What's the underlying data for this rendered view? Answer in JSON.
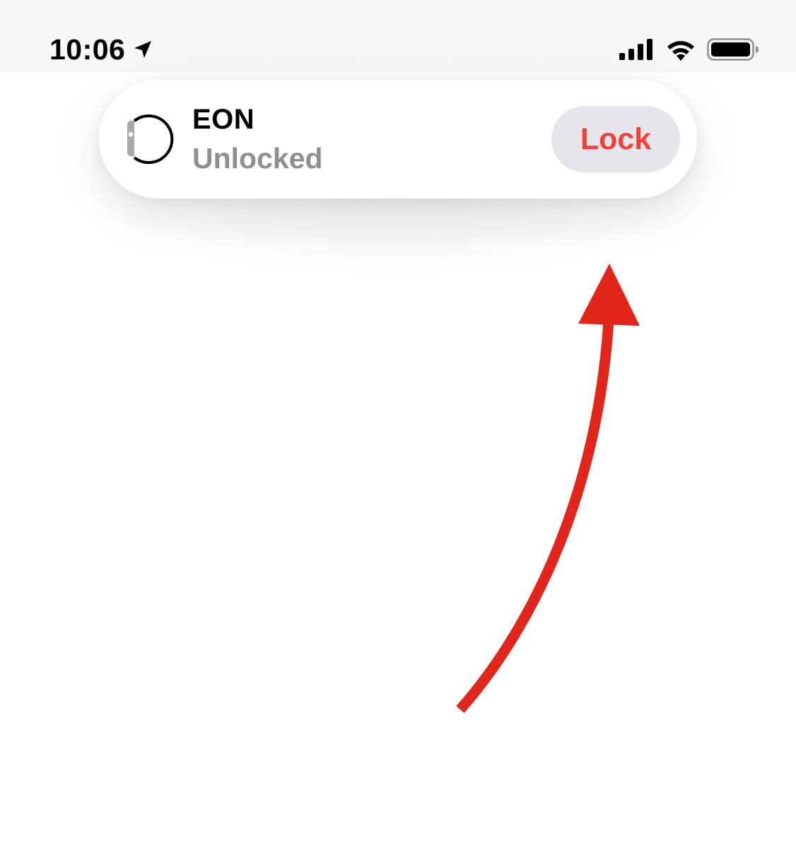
{
  "status_bar": {
    "time": "10:06",
    "location_icon": "location-arrow-icon",
    "signal_icon": "cellular-signal-icon",
    "wifi_icon": "wifi-icon",
    "battery_icon": "battery-full-icon"
  },
  "device_pill": {
    "icon": "apple-watch-icon",
    "name": "EON",
    "status": "Unlocked",
    "lock_label": "Lock"
  },
  "annotation": {
    "arrow_icon": "red-curved-arrow-icon",
    "color": "#e2261b"
  },
  "colors": {
    "lock_text": "#f2403b",
    "lock_bg": "#e5e5ea",
    "status_gray": "#8e8e93",
    "status_bar_bg": "#f7f7f7"
  }
}
